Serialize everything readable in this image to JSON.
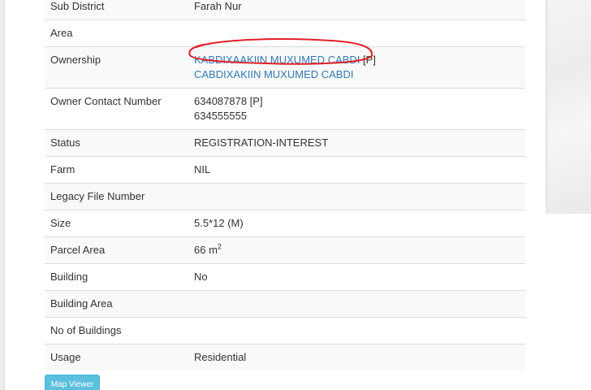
{
  "details": {
    "sub_district": {
      "label": "Sub District",
      "value": "Farah Nur"
    },
    "area": {
      "label": "Area",
      "value": ""
    },
    "ownership": {
      "label": "Ownership",
      "owner1": "KABDIXAAKIIN MUXUMED CABDI",
      "owner1_tag": " [P]",
      "owner2": "CABDIXAKIIN MUXUMED CABDI"
    },
    "owner_contact": {
      "label": "Owner Contact Number",
      "phone1": "634087878 [P]",
      "phone2": "634555555"
    },
    "status": {
      "label": "Status",
      "value": "REGISTRATION-INTEREST"
    },
    "farm": {
      "label": "Farm",
      "value": "NIL"
    },
    "legacy_file_number": {
      "label": "Legacy File Number",
      "value": ""
    },
    "size": {
      "label": "Size",
      "value": "5.5*12 (M)"
    },
    "parcel_area": {
      "label": "Parcel Area",
      "value": "66 m",
      "unit_sup": "2"
    },
    "building": {
      "label": "Building",
      "value": "No"
    },
    "building_area": {
      "label": "Building Area",
      "value": ""
    },
    "no_of_buildings": {
      "label": "No of Buildings",
      "value": ""
    },
    "usage": {
      "label": "Usage",
      "value": "Residential"
    }
  },
  "map_viewer_button": "Map Viewer",
  "colors": {
    "link": "#337ab7",
    "annotation": "#e0202a",
    "button": "#5bc0de",
    "stripe": "#f9f9f9",
    "border": "#dddddd"
  }
}
